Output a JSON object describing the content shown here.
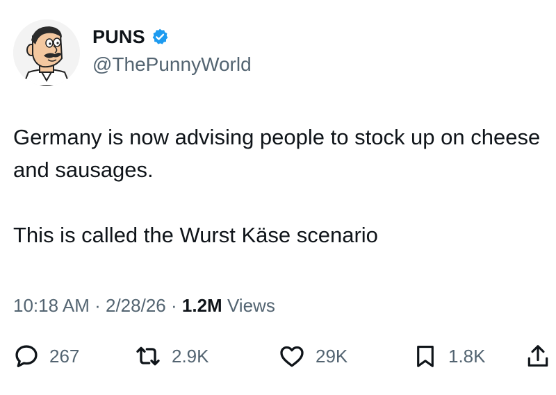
{
  "user": {
    "display_name": "PUNS",
    "handle": "@ThePunnyWorld",
    "verified": true,
    "avatar_icon": "cartoon-character-avatar"
  },
  "tweet": {
    "paragraphs": [
      "Germany is now advising people to stock up on cheese and sausages.",
      "This is called the Wurst Käse scenario"
    ],
    "time": "10:18 AM",
    "separator": "·",
    "date": "2/28/26",
    "views_count": "1.2M",
    "views_label": "Views"
  },
  "actions": {
    "replies": "267",
    "retweets": "2.9K",
    "likes": "29K",
    "bookmarks": "1.8K"
  },
  "colors": {
    "text": "#0f1419",
    "secondary": "#536471",
    "verified_badge": "#1d9bf0"
  }
}
